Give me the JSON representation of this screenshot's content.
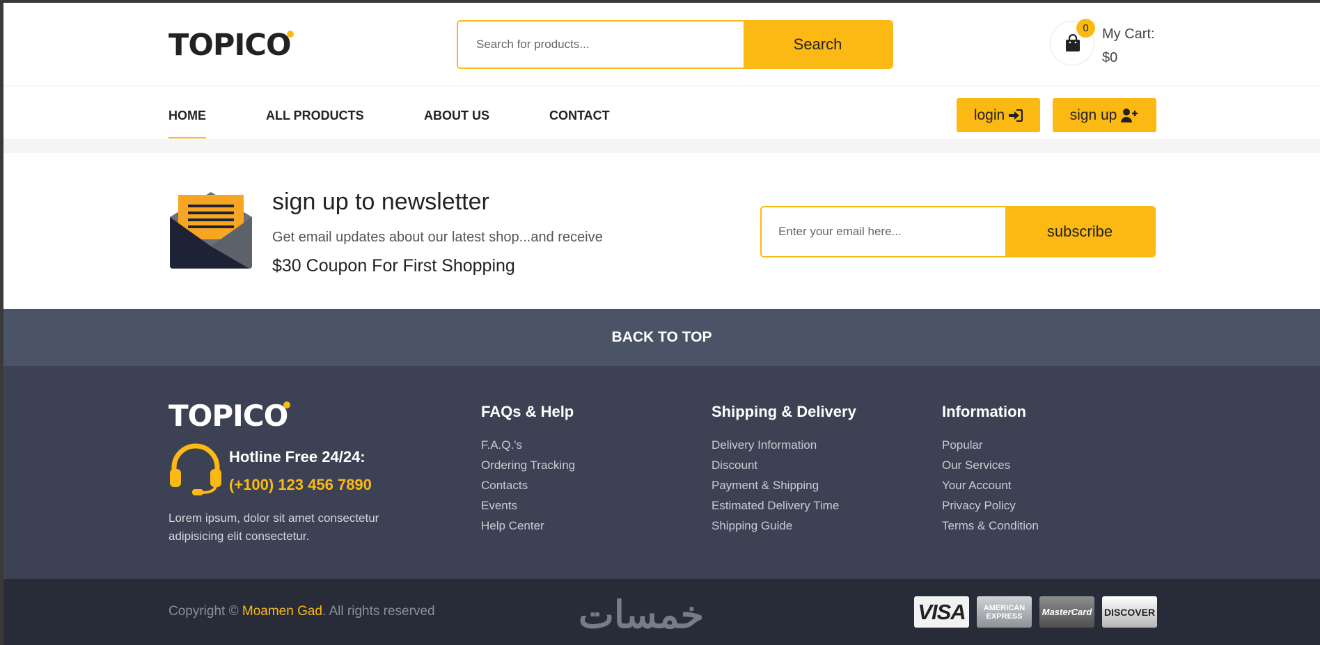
{
  "brand": {
    "logo_text": "TOPICO",
    "accent_color": "#fdb913"
  },
  "search": {
    "placeholder": "Search for products...",
    "button_label": "Search"
  },
  "cart": {
    "count": "0",
    "label_line1": "My Cart:",
    "label_line2": "$0",
    "icon": "shopping-bag-icon"
  },
  "nav": {
    "items": [
      {
        "label": "HOME",
        "active": true
      },
      {
        "label": "ALL PRODUCTS"
      },
      {
        "label": "ABOUT US"
      },
      {
        "label": "CONTACT"
      }
    ],
    "login_label": "login",
    "signup_label": "sign up"
  },
  "newsletter": {
    "title": "sign up to newsletter",
    "subtitle": "Get email updates about our latest shop...and receive",
    "coupon": "$30 Coupon For First Shopping",
    "email_placeholder": "Enter your email here...",
    "button_label": "subscribe"
  },
  "back_to_top": "BACK TO TOP",
  "footer": {
    "logo_text": "TOPICO",
    "hotline_label": "Hotline Free 24/24:",
    "hotline_number": "(+100) 123 456 7890",
    "about": "Lorem ipsum, dolor sit amet consectetur adipisicing elit consectetur.",
    "columns": [
      {
        "title": "FAQs & Help",
        "links": [
          "F.A.Q.'s",
          "Ordering Tracking",
          "Contacts",
          "Events",
          "Help Center"
        ]
      },
      {
        "title": "Shipping & Delivery",
        "links": [
          "Delivery Information",
          "Discount",
          "Payment & Shipping",
          "Estimated Delivery Time",
          "Shipping Guide"
        ]
      },
      {
        "title": "Information",
        "links": [
          "Popular",
          "Our Services",
          "Your Account",
          "Privacy Policy",
          "Terms & Condition"
        ]
      }
    ]
  },
  "bottom": {
    "copyright_prefix": "Copyright © ",
    "author": "Moamen Gad",
    "copyright_suffix": ". All rights reserved",
    "watermark": "خمسات",
    "payment_cards": {
      "visa": "VISA",
      "amex_line1": "AMERICAN",
      "amex_line2": "EXPRESS",
      "mastercard": "MasterCard",
      "discover": "DISCOVER"
    }
  }
}
